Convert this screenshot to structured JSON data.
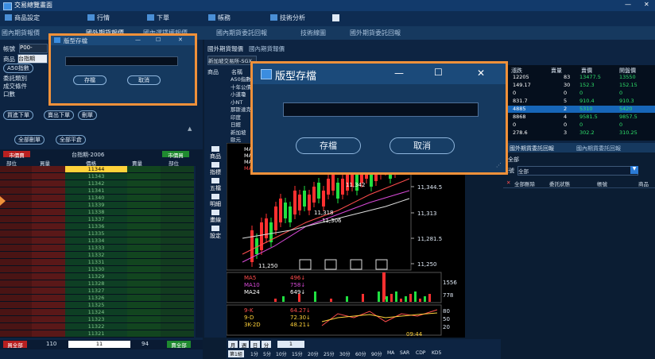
{
  "app": {
    "title": "交易總覽畫面",
    "minimize": "—",
    "close": "✕"
  },
  "menu": [
    {
      "label": "商品設定"
    },
    {
      "label": "行情"
    },
    {
      "label": "下單"
    },
    {
      "label": "帳務"
    },
    {
      "label": "技術分析"
    }
  ],
  "tabs": [
    {
      "label": "國內期貨報價",
      "active": false
    },
    {
      "label": "國外期貨報價",
      "active": true
    },
    {
      "label": "國內選擇權報價"
    },
    {
      "label": "國內期貨委託回報"
    },
    {
      "label": "技術線圖"
    },
    {
      "label": "國外期貨委託回報"
    }
  ],
  "left": {
    "account_label": "帳號",
    "account_value": "P00-",
    "product_label": "商品",
    "product_value": "台指期",
    "a50": "A50指數",
    "order_type_label": "委託類別",
    "trade_cond_label": "成交條件",
    "qty_label": "口數",
    "btn_close_all": "全部平倉",
    "btn_cancel_all": "全部刪單",
    "btn_cancel_order": "刪單",
    "btn_buy_order": "買進下單",
    "btn_sell_order": "賣出下單",
    "book_title": "台指期-2006",
    "book_buy_tag": "市價買",
    "book_sell_tag": "市價賣",
    "col_price": "價格",
    "col_buy": "買量",
    "col_sell": "賣量",
    "col_pos": "部位",
    "prices": [
      "11344",
      "11343",
      "11342",
      "11341",
      "11340",
      "11339",
      "11338",
      "11337",
      "11336",
      "11335",
      "11334",
      "11333",
      "11332",
      "11331",
      "11330",
      "11329",
      "11328",
      "11327",
      "11326",
      "11325",
      "11324",
      "11323",
      "11322",
      "11321"
    ],
    "footer_buy_all": "買全部",
    "footer_qty_left": "110",
    "footer_qty_center": "11",
    "footer_qty_right": "94",
    "footer_sell_all": "賣全部"
  },
  "quotes": {
    "headers": [
      "商品",
      "名稱",
      "成交價",
      "漲跌",
      "賣量",
      "賣價",
      "開盤價"
    ],
    "names": [
      "A50指數",
      "十年公債",
      "小道瓊",
      "小NT",
      "那斯達克",
      "印度",
      "日經",
      "新加坡",
      "歐元"
    ],
    "rows": [
      [
        "12205",
        "83",
        "13477.5",
        "13550"
      ],
      [
        "149.17",
        "30",
        "152.3",
        "152.15"
      ],
      [
        "0",
        "0",
        "0",
        "0"
      ],
      [
        "831.7",
        "5",
        "910.4",
        "910.3"
      ],
      [
        "4885",
        "2",
        "5310",
        "5420"
      ],
      [
        "8868",
        "4",
        "9581.5",
        "9857.5"
      ],
      [
        "0",
        "0",
        "0",
        "0"
      ],
      [
        "278.6",
        "3",
        "302.2",
        "310.25"
      ]
    ],
    "left_nums": [
      "1",
      "2",
      "0",
      "1",
      "1",
      "1",
      "0",
      "1"
    ],
    "source_label": "新加坡交易所-SGX"
  },
  "toolbox": [
    {
      "label": "商品"
    },
    {
      "label": "指標"
    },
    {
      "label": "五檔"
    },
    {
      "label": "明細"
    },
    {
      "label": "畫線"
    },
    {
      "label": "設定"
    }
  ],
  "chart_data": {
    "type": "candlestick",
    "price_ticks": [
      "11,344.5",
      "11,313",
      "11,281.5",
      "11,250"
    ],
    "annotations": [
      "11,342",
      "11,318",
      "11,306",
      "11,250"
    ],
    "ma_legend": [
      {
        "name": "MA5",
        "value": "496↓",
        "color": "#ff4d4d"
      },
      {
        "name": "MA10",
        "value": "758↓",
        "color": "#d84ad8"
      },
      {
        "name": "MA24",
        "value": "649↓",
        "color": "#ffffff"
      }
    ],
    "volume_ticks": [
      "1556",
      "778"
    ],
    "kd_legend": [
      {
        "name": "9-K",
        "value": "64.27↓",
        "color": "#ff4d4d"
      },
      {
        "name": "9-D",
        "value": "72.30↓",
        "color": "#ffd23a"
      },
      {
        "name": "3K-2D",
        "value": "48.21↓",
        "color": "#ffd23a"
      }
    ],
    "kd_ticks": [
      "80",
      "50",
      "20"
    ],
    "time_label": "09:44",
    "ma_labels_top": [
      "MA",
      "MA",
      "MA",
      "MA20"
    ],
    "ma20_value": "11326.58↓"
  },
  "chart_toolbar": {
    "period_labels": [
      "月",
      "週",
      "日",
      "分"
    ],
    "interval_value": "1",
    "time_buttons": [
      "第1組",
      "1分",
      "5分",
      "10分",
      "15分",
      "20分",
      "25分",
      "30分",
      "60分",
      "90分",
      "MA",
      "SAR",
      "CDP",
      "KD5"
    ]
  },
  "reports": {
    "tab1": "國外期貨委託回報",
    "tab2": "國內期貨委託回報",
    "subtab": "全部",
    "filter_label": "帳號",
    "filter_value": "全部",
    "cols": [
      "全部刪除",
      "委託狀態",
      "帳號",
      "商品"
    ]
  },
  "dialog": {
    "title": "版型存檔",
    "input_value": "",
    "save_label": "存檔",
    "cancel_label": "取消",
    "min": "—",
    "max": "☐",
    "close": "✕"
  },
  "colors": {
    "accent": "#f0913a",
    "up": "#ff3030",
    "down": "#20e040",
    "bg": "#0b1d33"
  }
}
